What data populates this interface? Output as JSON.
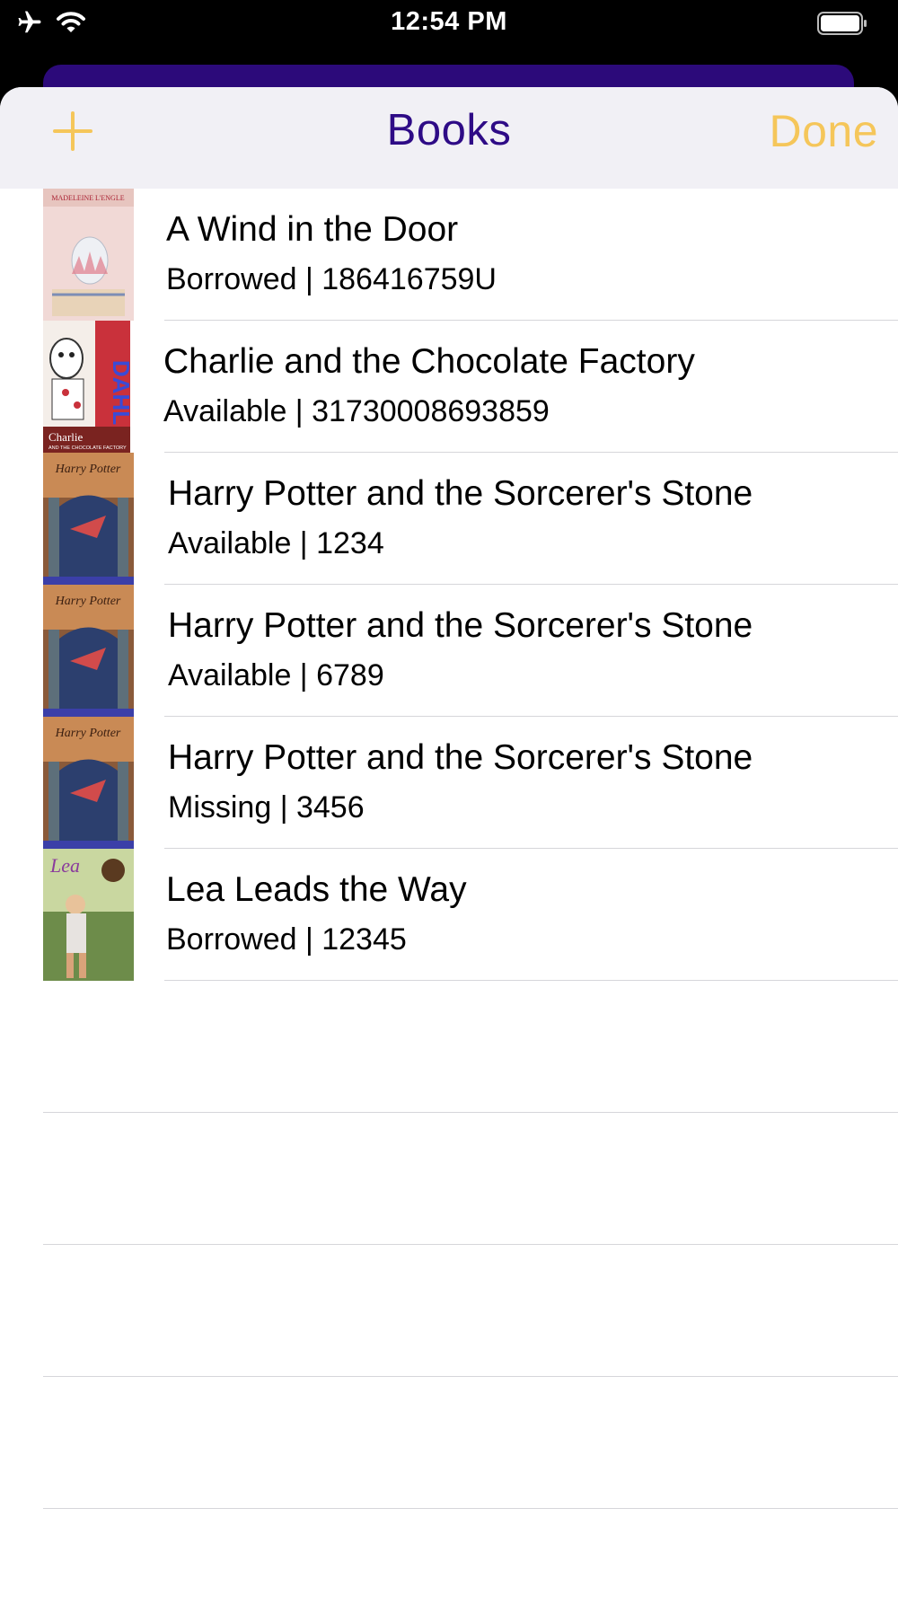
{
  "status_bar": {
    "time": "12:54 PM",
    "icons": [
      "airplane-icon",
      "wifi-icon",
      "battery-icon"
    ]
  },
  "nav": {
    "title": "Books",
    "done_label": "Done",
    "add_icon": "plus-icon"
  },
  "colors": {
    "accent": "#f5c65a",
    "title": "#2e0b86",
    "nav_background": "#f1f0f5",
    "underlay": "#2c0a7a"
  },
  "books": [
    {
      "title": "A Wind in the Door",
      "subtitle": "Borrowed | 186416759U",
      "cover_text": "MADELEINE L'ENGLE"
    },
    {
      "title": "Charlie and the Chocolate Factory",
      "subtitle": "Available | 31730008693859",
      "cover_text": "DAHL"
    },
    {
      "title": "Harry Potter and the Sorcerer's Stone",
      "subtitle": "Available | 1234",
      "cover_text": "Harry Potter"
    },
    {
      "title": "Harry Potter and the Sorcerer's Stone",
      "subtitle": "Available | 6789",
      "cover_text": "Harry Potter"
    },
    {
      "title": "Harry Potter and the Sorcerer's Stone",
      "subtitle": "Missing | 3456",
      "cover_text": "Harry Potter"
    },
    {
      "title": "Lea Leads the Way",
      "subtitle": "Borrowed | 12345",
      "cover_text": "Lea"
    }
  ]
}
